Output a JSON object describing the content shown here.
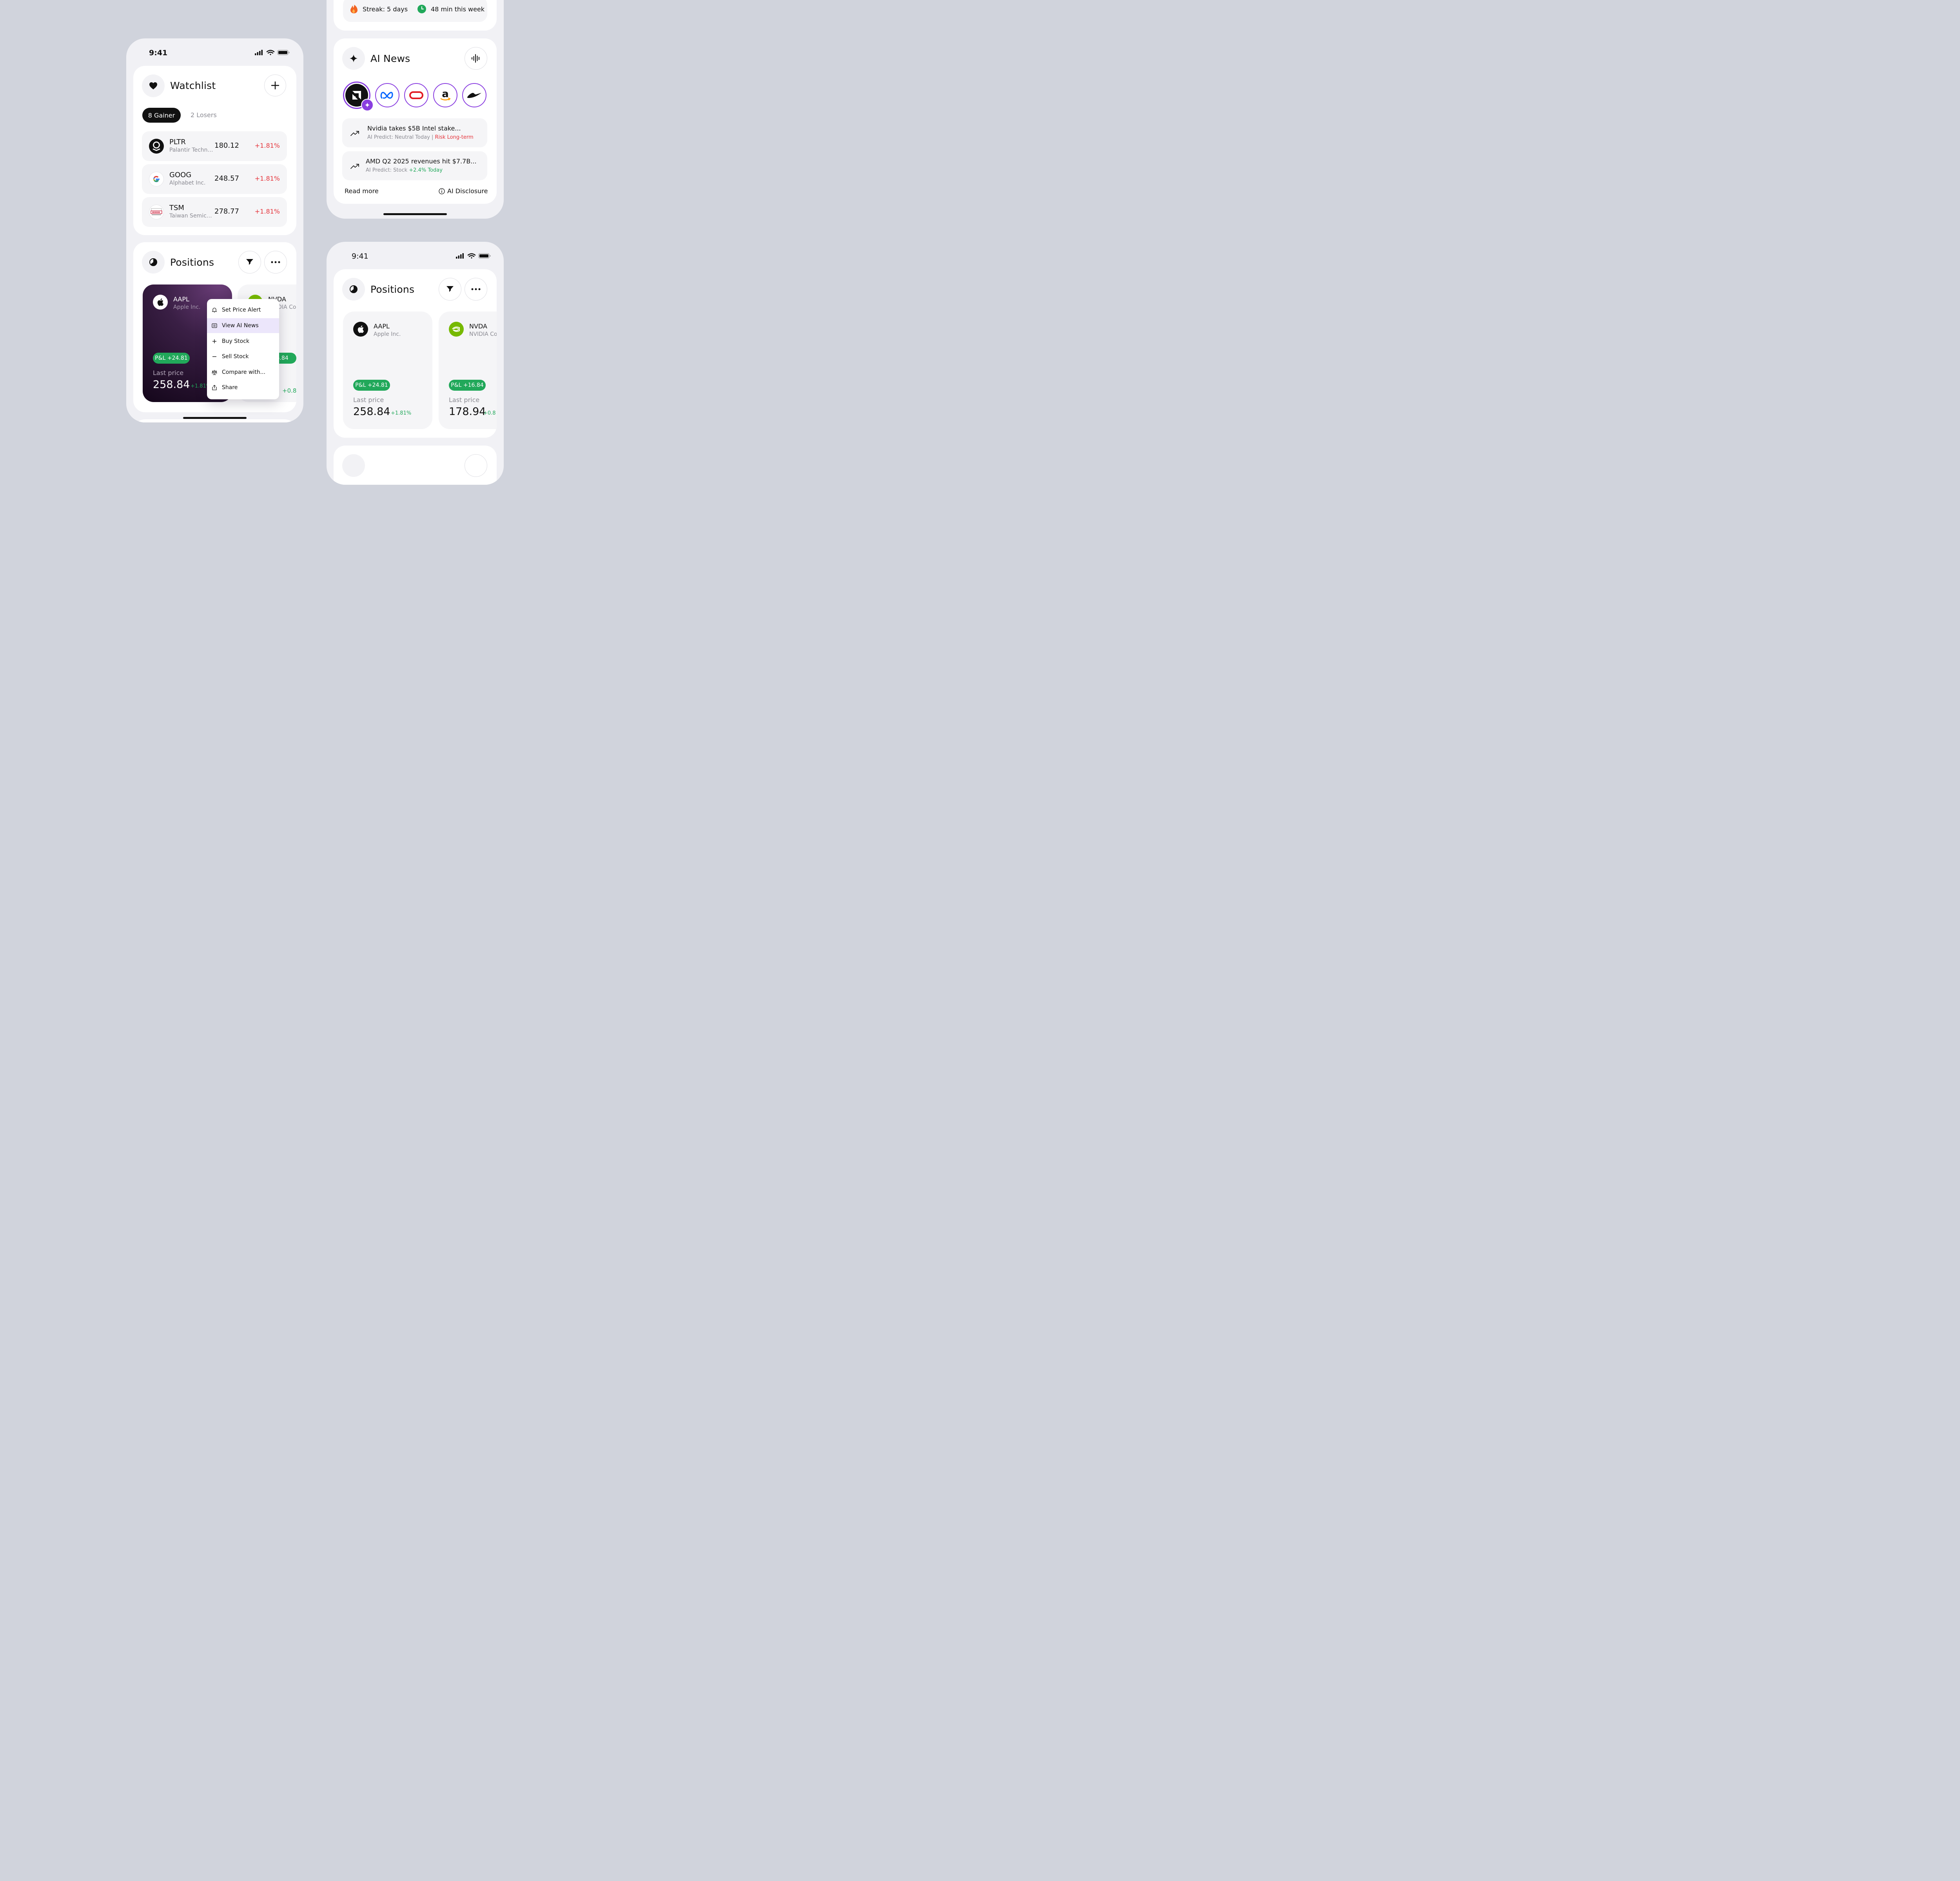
{
  "phone1": {
    "status_time": "9:41",
    "watchlist": {
      "title": "Watchlist",
      "tab_active": "8 Gainer",
      "tab_inactive": "2 Losers",
      "rows": [
        {
          "ticker": "PLTR",
          "name": "Palantir Techno...",
          "price": "180.12",
          "change": "+1.81%"
        },
        {
          "ticker": "GOOG",
          "name": "Alphabet Inc.",
          "price": "248.57",
          "change": "+1.81%"
        },
        {
          "ticker": "TSM",
          "name": "Taiwan Semico...",
          "price": "278.77",
          "change": "+1.81%"
        }
      ]
    },
    "positions": {
      "title": "Positions",
      "card": {
        "ticker": "AAPL",
        "name": "Apple Inc.",
        "pnl": "P&L +24.81",
        "last_label": "Last price",
        "price": "258.84",
        "change": "+1.81%"
      },
      "card2": {
        "ticker": "NVDA",
        "name": "NVIDIA Co",
        "pnl": "P&L +16.84",
        "change": "+0.8"
      }
    },
    "menu": [
      "Set Price Alert",
      "View AI News",
      "Buy Stock",
      "Sell Stock",
      "Compare with...",
      "Share"
    ]
  },
  "phone2": {
    "streak": "Streak: 5 days",
    "minutes": "48 min this week",
    "ai_news": {
      "title": "AI News",
      "stories": [
        "amd-logo",
        "meta-logo",
        "oracle-logo",
        "amazon-logo",
        "nike-logo"
      ],
      "items": [
        {
          "headline": "Nvidia takes $5B Intel stake...",
          "predict_prefix": "AI Predict: Neutral Today | ",
          "predict_highlight": "Risk Long-term",
          "highlight_color": "#e5343b"
        },
        {
          "headline": "AMD Q2 2025 revenues hit $7.7B...",
          "predict_prefix": "AI Predict: Stock ",
          "predict_highlight": "+2.4% Today",
          "highlight_color": "#21a85a"
        }
      ],
      "read_more": "Read more",
      "disclosure": "AI Disclosure"
    }
  },
  "phone3": {
    "status_time": "9:41",
    "positions": {
      "title": "Positions",
      "cards": [
        {
          "ticker": "AAPL",
          "name": "Apple Inc.",
          "pnl": "P&L +24.81",
          "last_label": "Last price",
          "price": "258.84",
          "change": "+1.81%"
        },
        {
          "ticker": "NVDA",
          "name": "NVIDIA Co",
          "pnl": "P&L +16.84",
          "last_label": "Last price",
          "price": "178.94",
          "change": "+0.8"
        }
      ]
    }
  },
  "colors": {
    "red": "#e5343b",
    "green": "#21a85a",
    "purple": "#8a3ee0",
    "background": "#d0d3dc"
  }
}
